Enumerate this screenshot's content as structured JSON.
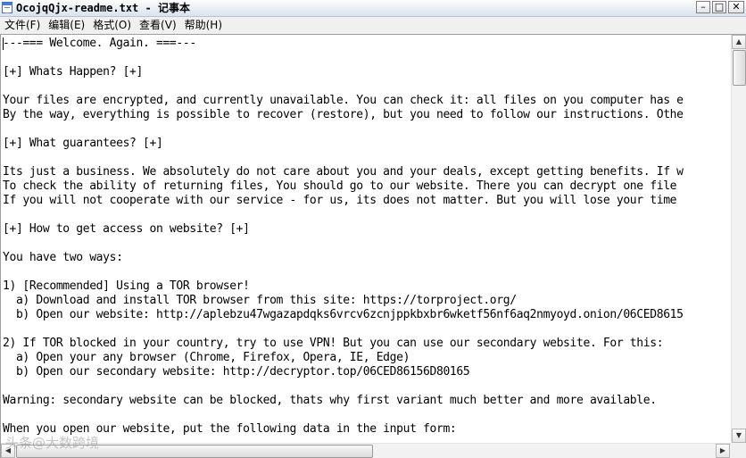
{
  "window": {
    "title": "OcojqQjx-readme.txt - 记事本",
    "minimize_glyph": "–",
    "maximize_glyph": "□",
    "close_glyph": "✕",
    "icon": "notepad-icon"
  },
  "menu": {
    "items": [
      {
        "label": "文件(F)"
      },
      {
        "label": "编辑(E)"
      },
      {
        "label": "格式(O)"
      },
      {
        "label": "查看(V)"
      },
      {
        "label": "帮助(H)"
      }
    ]
  },
  "document": {
    "lines": [
      "---=== Welcome. Again. ===---",
      "",
      "[+] Whats Happen? [+]",
      "",
      "Your files are encrypted, and currently unavailable. You can check it: all files on you computer has e",
      "By the way, everything is possible to recover (restore), but you need to follow our instructions. Othe",
      "",
      "[+] What guarantees? [+]",
      "",
      "Its just a business. We absolutely do not care about you and your deals, except getting benefits. If w",
      "To check the ability of returning files, You should go to our website. There you can decrypt one file ",
      "If you will not cooperate with our service - for us, its does not matter. But you will lose your time ",
      "",
      "[+] How to get access on website? [+]",
      "",
      "You have two ways:",
      "",
      "1) [Recommended] Using a TOR browser!",
      "  a) Download and install TOR browser from this site: https://torproject.org/",
      "  b) Open our website: http://aplebzu47wgazapdqks6vrcv6zcnjppkbxbr6wketf56nf6aq2nmyoyd.onion/06CED8615",
      "",
      "2) If TOR blocked in your country, try to use VPN! But you can use our secondary website. For this:",
      "  a) Open your any browser (Chrome, Firefox, Opera, IE, Edge)",
      "  b) Open our secondary website: http://decryptor.top/06CED86156D80165",
      "",
      "Warning: secondary website can be blocked, thats why first variant much better and more available.",
      "",
      "When you open our website, put the following data in the input form:"
    ]
  },
  "scrollbars": {
    "up_glyph": "▲",
    "down_glyph": "▼",
    "left_glyph": "◀",
    "right_glyph": "▶"
  },
  "watermark": {
    "text": "头条@大数跨境"
  }
}
